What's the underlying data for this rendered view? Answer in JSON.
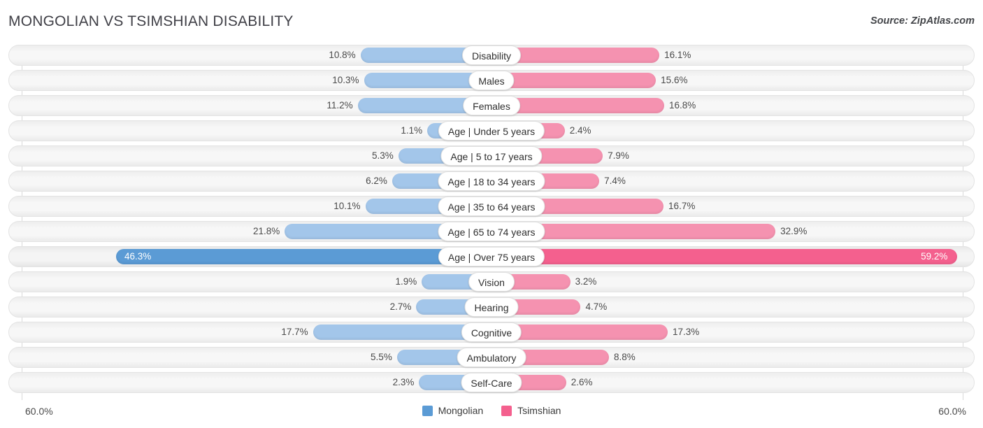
{
  "header": {
    "title": "MONGOLIAN VS TSIMSHIAN DISABILITY",
    "source": "Source: ZipAtlas.com"
  },
  "axis": {
    "left_tick": "60.0%",
    "right_tick": "60.0%",
    "max": 60.0
  },
  "legend": {
    "items": [
      {
        "label": "Mongolian",
        "color": "#5b9bd5"
      },
      {
        "label": "Tsimshian",
        "color": "#f4608e"
      }
    ]
  },
  "colors": {
    "left_bar": "#a3c6ea",
    "right_bar": "#f592b0",
    "left_bar_highlight": "#5b9bd5",
    "right_bar_highlight": "#f4608e",
    "track": "#f5f5f5"
  },
  "chart_data": {
    "type": "bar",
    "title": "MONGOLIAN VS TSIMSHIAN DISABILITY",
    "subtitle": "",
    "xlabel": "",
    "ylabel": "",
    "orientation": "horizontal-diverging",
    "xlim": [
      60.0,
      60.0
    ],
    "grid": false,
    "legend_position": "bottom-center",
    "categories": [
      "Disability",
      "Males",
      "Females",
      "Age | Under 5 years",
      "Age | 5 to 17 years",
      "Age | 18 to 34 years",
      "Age | 35 to 64 years",
      "Age | 65 to 74 years",
      "Age | Over 75 years",
      "Vision",
      "Hearing",
      "Cognitive",
      "Ambulatory",
      "Self-Care"
    ],
    "series": [
      {
        "name": "Mongolian",
        "color": "#5b9bd5",
        "values": [
          10.8,
          10.3,
          11.2,
          1.1,
          5.3,
          6.2,
          10.1,
          21.8,
          46.3,
          1.9,
          2.7,
          17.7,
          5.5,
          2.3
        ],
        "labels": [
          "10.8%",
          "10.3%",
          "11.2%",
          "1.1%",
          "5.3%",
          "6.2%",
          "10.1%",
          "21.8%",
          "46.3%",
          "1.9%",
          "2.7%",
          "17.7%",
          "5.5%",
          "2.3%"
        ]
      },
      {
        "name": "Tsimshian",
        "color": "#f4608e",
        "values": [
          16.1,
          15.6,
          16.8,
          2.4,
          7.9,
          7.4,
          16.7,
          32.9,
          59.2,
          3.2,
          4.7,
          17.3,
          8.8,
          2.6
        ],
        "labels": [
          "16.1%",
          "15.6%",
          "16.8%",
          "2.4%",
          "7.9%",
          "7.4%",
          "16.7%",
          "32.9%",
          "59.2%",
          "3.2%",
          "4.7%",
          "17.3%",
          "8.8%",
          "2.6%"
        ]
      }
    ],
    "highlighted_rows": [
      8
    ]
  },
  "rows": [
    {
      "label": "Disability",
      "left_value": 10.8,
      "right_value": 16.1,
      "left_label": "10.8%",
      "right_label": "16.1%",
      "highlight": false
    },
    {
      "label": "Males",
      "left_value": 10.3,
      "right_value": 15.6,
      "left_label": "10.3%",
      "right_label": "15.6%",
      "highlight": false
    },
    {
      "label": "Females",
      "left_value": 11.2,
      "right_value": 16.8,
      "left_label": "11.2%",
      "right_label": "16.8%",
      "highlight": false
    },
    {
      "label": "Age | Under 5 years",
      "left_value": 1.1,
      "right_value": 2.4,
      "left_label": "1.1%",
      "right_label": "2.4%",
      "highlight": false
    },
    {
      "label": "Age | 5 to 17 years",
      "left_value": 5.3,
      "right_value": 7.9,
      "left_label": "5.3%",
      "right_label": "7.9%",
      "highlight": false
    },
    {
      "label": "Age | 18 to 34 years",
      "left_value": 6.2,
      "right_value": 7.4,
      "left_label": "6.2%",
      "right_label": "7.4%",
      "highlight": false
    },
    {
      "label": "Age | 35 to 64 years",
      "left_value": 10.1,
      "right_value": 16.7,
      "left_label": "10.1%",
      "right_label": "16.7%",
      "highlight": false
    },
    {
      "label": "Age | 65 to 74 years",
      "left_value": 21.8,
      "right_value": 32.9,
      "left_label": "21.8%",
      "right_label": "32.9%",
      "highlight": false
    },
    {
      "label": "Age | Over 75 years",
      "left_value": 46.3,
      "right_value": 59.2,
      "left_label": "46.3%",
      "right_label": "59.2%",
      "highlight": true
    },
    {
      "label": "Vision",
      "left_value": 1.9,
      "right_value": 3.2,
      "left_label": "1.9%",
      "right_label": "3.2%",
      "highlight": false
    },
    {
      "label": "Hearing",
      "left_value": 2.7,
      "right_value": 4.7,
      "left_label": "2.7%",
      "right_label": "4.7%",
      "highlight": false
    },
    {
      "label": "Cognitive",
      "left_value": 17.7,
      "right_value": 17.3,
      "left_label": "17.7%",
      "right_label": "17.3%",
      "highlight": false
    },
    {
      "label": "Ambulatory",
      "left_value": 5.5,
      "right_value": 8.8,
      "left_label": "5.5%",
      "right_label": "8.8%",
      "highlight": false
    },
    {
      "label": "Self-Care",
      "left_value": 2.3,
      "right_value": 2.6,
      "left_label": "2.3%",
      "right_label": "2.6%",
      "highlight": false
    }
  ]
}
